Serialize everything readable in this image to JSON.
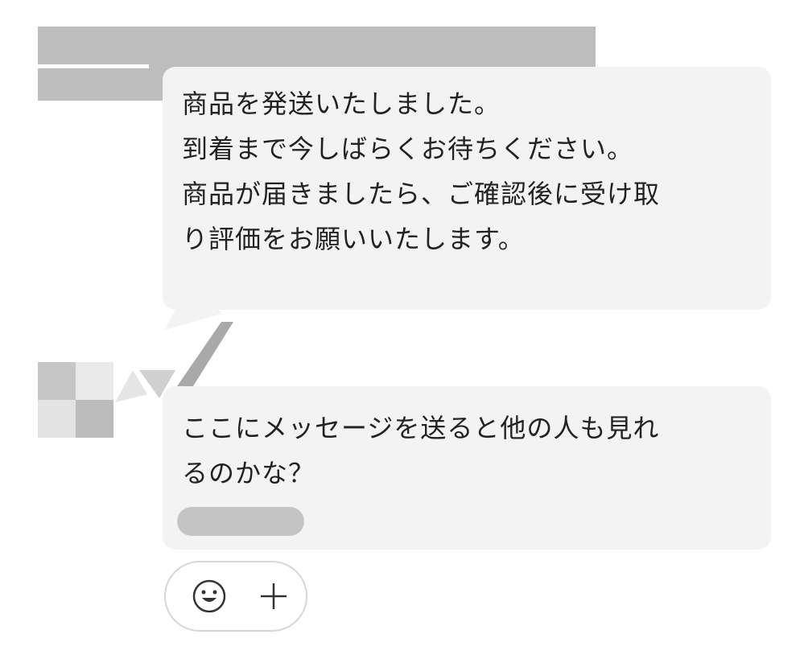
{
  "messages": [
    {
      "lines": [
        "商品を発送いたしました。",
        "到着まで今しばらくお待ちください。",
        "商品が届きましたら、ご確認後に受け取",
        "り評価をお願いいたします。"
      ]
    },
    {
      "lines": [
        "ここにメッセージを送ると他の人も見れ",
        "るのかな？"
      ]
    }
  ],
  "reaction": {
    "emoji_icon": "smile-icon",
    "add_icon": "plus-icon"
  },
  "colors": {
    "bubble": "#f3f3f3",
    "redaction": "#bdbdbd",
    "text": "#222222",
    "border": "#d6d6d6"
  }
}
